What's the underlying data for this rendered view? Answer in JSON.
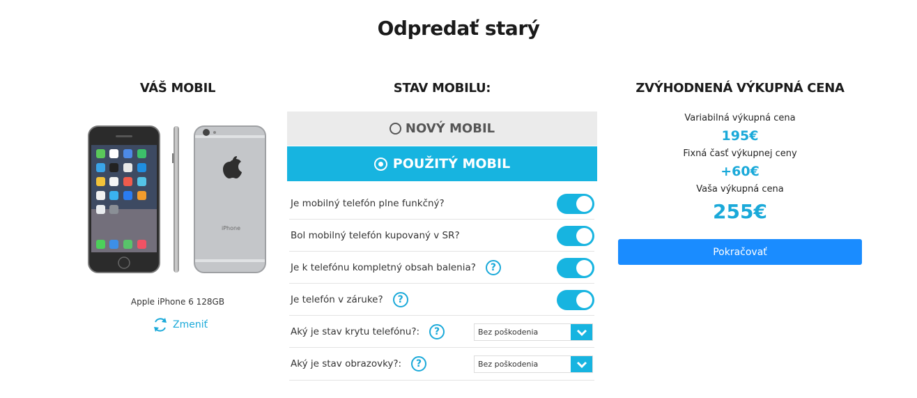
{
  "page_title": "Odpredať starý",
  "your_phone": {
    "title": "VÁŠ MOBIL",
    "model": "Apple iPhone 6 128GB",
    "change_label": "Zmeniť",
    "change_icon": "refresh-icon"
  },
  "phone_state": {
    "title": "STAV MOBILU:",
    "new_label": "NOVÝ MOBIL",
    "used_label": "POUŽITÝ MOBIL",
    "selected": "used",
    "questions": [
      {
        "text": "Je mobilný telefón plne funkčný?",
        "help": false,
        "control": "toggle",
        "value": true
      },
      {
        "text": "Bol mobilný telefón kupovaný v SR?",
        "help": false,
        "control": "toggle",
        "value": true
      },
      {
        "text": "Je k telefónu kompletný obsah balenia?",
        "help": true,
        "control": "toggle",
        "value": true
      },
      {
        "text": "Je telefón v záruke?",
        "help": true,
        "control": "toggle",
        "value": true
      },
      {
        "text": "Aký je stav krytu telefónu?:",
        "help": true,
        "control": "select",
        "value": "Bez poškodenia"
      },
      {
        "text": "Aký je stav obrazovky?:",
        "help": true,
        "control": "select",
        "value": "Bez poškodenia"
      }
    ],
    "help_glyph": "?"
  },
  "price": {
    "title": "ZVÝHODNENÁ VÝKUPNÁ CENA",
    "variable_label": "Variabilná výkupná cena",
    "variable_value": "195€",
    "fixed_label": "Fixná časť výkupnej ceny",
    "fixed_value": "+60€",
    "total_label": "Vaša výkupná cena",
    "total_value": "255€",
    "continue_label": "Pokračovať"
  },
  "colors": {
    "accent": "#17b4e0",
    "button": "#1a8cff",
    "state_inactive_bg": "#ebebeb"
  }
}
